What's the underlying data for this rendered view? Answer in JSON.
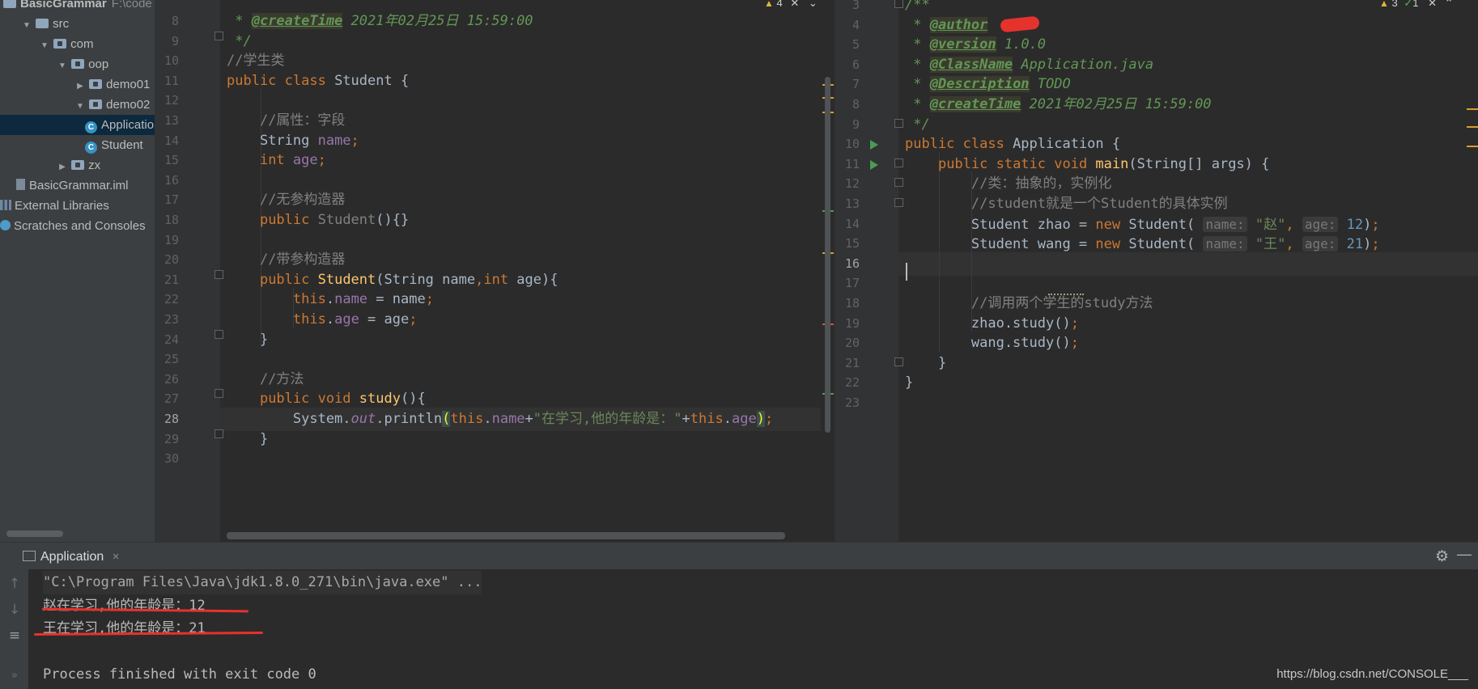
{
  "project_tree": {
    "items": [
      {
        "label": "BasicGrammar",
        "suffix": "F:\\code",
        "indent": 0,
        "type": "module"
      },
      {
        "label": "src",
        "indent": 1,
        "type": "folder"
      },
      {
        "label": "com",
        "indent": 2,
        "type": "package"
      },
      {
        "label": "oop",
        "indent": 3,
        "type": "package"
      },
      {
        "label": "demo01",
        "indent": 4,
        "type": "package"
      },
      {
        "label": "demo02",
        "indent": 4,
        "type": "package"
      },
      {
        "label": "Application",
        "indent": 5,
        "type": "class"
      },
      {
        "label": "Student",
        "indent": 5,
        "type": "class"
      },
      {
        "label": "zx",
        "indent": 3,
        "type": "package"
      },
      {
        "label": "BasicGrammar.iml",
        "indent": 1,
        "type": "file"
      },
      {
        "label": "External Libraries",
        "indent": 0,
        "type": "library"
      },
      {
        "label": "Scratches and Consoles",
        "indent": 0,
        "type": "scratch"
      }
    ]
  },
  "left_editor": {
    "warnings": "4",
    "lines": [
      {
        "n": "8",
        "tokens": [
          [
            "doc",
            " * "
          ],
          [
            "tag",
            "@createTime"
          ],
          [
            "doc",
            " 2021年02月25日 15:59:00"
          ]
        ]
      },
      {
        "n": "9",
        "tokens": [
          [
            "doc",
            " */"
          ]
        ]
      },
      {
        "n": "10",
        "tokens": [
          [
            "cmt",
            "//学生类"
          ]
        ]
      },
      {
        "n": "11",
        "tokens": [
          [
            "kw",
            "public class "
          ],
          [
            "plain",
            "Student {"
          ]
        ]
      },
      {
        "n": "12",
        "tokens": []
      },
      {
        "n": "13",
        "tokens": [
          [
            "plain",
            "    "
          ],
          [
            "cmt",
            "//属性：字段"
          ]
        ]
      },
      {
        "n": "14",
        "tokens": [
          [
            "plain",
            "    String "
          ],
          [
            "field",
            "name"
          ],
          [
            "kw",
            ";"
          ]
        ]
      },
      {
        "n": "15",
        "tokens": [
          [
            "plain",
            "    "
          ],
          [
            "kw",
            "int "
          ],
          [
            "field",
            "age"
          ],
          [
            "kw",
            ";"
          ]
        ]
      },
      {
        "n": "16",
        "tokens": []
      },
      {
        "n": "17",
        "tokens": [
          [
            "plain",
            "    "
          ],
          [
            "cmt",
            "//无参构造器"
          ]
        ]
      },
      {
        "n": "18",
        "tokens": [
          [
            "plain",
            "    "
          ],
          [
            "kw",
            "public "
          ],
          [
            "cmt",
            "Student"
          ],
          [
            "plain",
            "(){}"
          ]
        ]
      },
      {
        "n": "19",
        "tokens": []
      },
      {
        "n": "20",
        "tokens": [
          [
            "plain",
            "    "
          ],
          [
            "cmt",
            "//带参构造器"
          ]
        ]
      },
      {
        "n": "21",
        "tokens": [
          [
            "plain",
            "    "
          ],
          [
            "kw",
            "public "
          ],
          [
            "meth",
            "Student"
          ],
          [
            "plain",
            "(String name"
          ],
          [
            "kw",
            ","
          ],
          [
            "kw",
            "int "
          ],
          [
            "plain",
            "age){"
          ]
        ]
      },
      {
        "n": "22",
        "tokens": [
          [
            "plain",
            "        "
          ],
          [
            "kw",
            "this"
          ],
          [
            "plain",
            "."
          ],
          [
            "field",
            "name"
          ],
          [
            "plain",
            " = name"
          ],
          [
            "kw",
            ";"
          ]
        ]
      },
      {
        "n": "23",
        "tokens": [
          [
            "plain",
            "        "
          ],
          [
            "kw",
            "this"
          ],
          [
            "plain",
            "."
          ],
          [
            "field",
            "age"
          ],
          [
            "plain",
            " = age"
          ],
          [
            "kw",
            ";"
          ]
        ]
      },
      {
        "n": "24",
        "tokens": [
          [
            "plain",
            "    }"
          ]
        ]
      },
      {
        "n": "25",
        "tokens": []
      },
      {
        "n": "26",
        "tokens": [
          [
            "plain",
            "    "
          ],
          [
            "cmt",
            "//方法"
          ]
        ]
      },
      {
        "n": "27",
        "tokens": [
          [
            "plain",
            "    "
          ],
          [
            "kw",
            "public void "
          ],
          [
            "meth",
            "study"
          ],
          [
            "plain",
            "(){"
          ]
        ]
      },
      {
        "n": "28",
        "tokens": [
          [
            "plain",
            "        System."
          ],
          [
            "static",
            "out"
          ],
          [
            "plain",
            ".println"
          ],
          [
            "brace",
            "("
          ],
          [
            "kw",
            "this"
          ],
          [
            "plain",
            "."
          ],
          [
            "field",
            "name"
          ],
          [
            "plain",
            "+"
          ],
          [
            "str",
            "\"在学习,他的年龄是：\""
          ],
          [
            "plain",
            "+"
          ],
          [
            "kw",
            "this"
          ],
          [
            "plain",
            "."
          ],
          [
            "field",
            "age"
          ],
          [
            "brace",
            ")"
          ],
          [
            "kw",
            ";"
          ]
        ]
      },
      {
        "n": "29",
        "tokens": [
          [
            "plain",
            "    }"
          ]
        ]
      },
      {
        "n": "30",
        "tokens": []
      }
    ]
  },
  "right_editor": {
    "warnings": "3",
    "checks": "1",
    "lines": [
      {
        "n": "3",
        "tokens": [
          [
            "doc",
            "/**"
          ]
        ]
      },
      {
        "n": "4",
        "tokens": [
          [
            "doc",
            " * "
          ],
          [
            "tag",
            "@author"
          ],
          [
            "doc",
            " "
          ]
        ]
      },
      {
        "n": "5",
        "tokens": [
          [
            "doc",
            " * "
          ],
          [
            "tag",
            "@version"
          ],
          [
            "doc",
            " 1.0.0"
          ]
        ]
      },
      {
        "n": "6",
        "tokens": [
          [
            "doc",
            " * "
          ],
          [
            "tag",
            "@ClassName"
          ],
          [
            "doc",
            " Application.java"
          ]
        ]
      },
      {
        "n": "7",
        "tokens": [
          [
            "doc",
            " * "
          ],
          [
            "tag",
            "@Description"
          ],
          [
            "doc",
            " TODO"
          ]
        ]
      },
      {
        "n": "8",
        "tokens": [
          [
            "doc",
            " * "
          ],
          [
            "tag",
            "@createTime"
          ],
          [
            "doc",
            " 2021年02月25日 15:59:00"
          ]
        ]
      },
      {
        "n": "9",
        "tokens": [
          [
            "doc",
            " */"
          ]
        ]
      },
      {
        "n": "10",
        "tokens": [
          [
            "kw",
            "public class "
          ],
          [
            "plain",
            "Application {"
          ]
        ]
      },
      {
        "n": "11",
        "tokens": [
          [
            "plain",
            "    "
          ],
          [
            "kw",
            "public static void "
          ],
          [
            "meth",
            "main"
          ],
          [
            "plain",
            "(String[] args) {"
          ]
        ]
      },
      {
        "n": "12",
        "tokens": [
          [
            "plain",
            "        "
          ],
          [
            "cmt",
            "//类：抽象的，实例化"
          ]
        ]
      },
      {
        "n": "13",
        "tokens": [
          [
            "plain",
            "        "
          ],
          [
            "cmt",
            "//student就是一个Student的具体实例"
          ]
        ]
      },
      {
        "n": "14",
        "tokens": [
          [
            "plain",
            "        Student zhao = "
          ],
          [
            "kw",
            "new "
          ],
          [
            "plain",
            "Student( "
          ],
          [
            "hint",
            "name:"
          ],
          [
            "plain",
            " "
          ],
          [
            "str",
            "\"赵\""
          ],
          [
            "kw",
            ", "
          ],
          [
            "hint",
            "age:"
          ],
          [
            "plain",
            " "
          ],
          [
            "num",
            "12"
          ],
          [
            "plain",
            ")"
          ],
          [
            "kw",
            ";"
          ]
        ]
      },
      {
        "n": "15",
        "tokens": [
          [
            "plain",
            "        Student wang = "
          ],
          [
            "kw",
            "new "
          ],
          [
            "plain",
            "Student( "
          ],
          [
            "hint",
            "name:"
          ],
          [
            "plain",
            " "
          ],
          [
            "str",
            "\"王\""
          ],
          [
            "kw",
            ", "
          ],
          [
            "hint",
            "age:"
          ],
          [
            "plain",
            " "
          ],
          [
            "num",
            "21"
          ],
          [
            "plain",
            ")"
          ],
          [
            "kw",
            ";"
          ]
        ]
      },
      {
        "n": "16",
        "tokens": []
      },
      {
        "n": "17",
        "tokens": []
      },
      {
        "n": "18",
        "tokens": [
          [
            "plain",
            "        "
          ],
          [
            "cmt",
            "//调用两个学生的study方法"
          ]
        ]
      },
      {
        "n": "19",
        "tokens": [
          [
            "plain",
            "        zhao.study()"
          ],
          [
            "kw",
            ";"
          ]
        ]
      },
      {
        "n": "20",
        "tokens": [
          [
            "plain",
            "        wang.study()"
          ],
          [
            "kw",
            ";"
          ]
        ]
      },
      {
        "n": "21",
        "tokens": [
          [
            "plain",
            "    }"
          ]
        ]
      },
      {
        "n": "22",
        "tokens": [
          [
            "plain",
            "}"
          ]
        ]
      },
      {
        "n": "23",
        "tokens": []
      }
    ]
  },
  "run_panel": {
    "tab_label": "Application",
    "close_glyph": "×",
    "console": [
      "\"C:\\Program Files\\Java\\jdk1.8.0_271\\bin\\java.exe\" ...",
      "赵在学习,他的年龄是：12",
      "王在学习,他的年龄是：21",
      "",
      "Process finished with exit code 0"
    ],
    "watermark": "https://blog.csdn.net/CONSOLE___"
  },
  "colors": {
    "accent": "#4a88c7",
    "annotation_red": "#e6322d",
    "keyword": "#cc7832",
    "string": "#6a8759"
  }
}
